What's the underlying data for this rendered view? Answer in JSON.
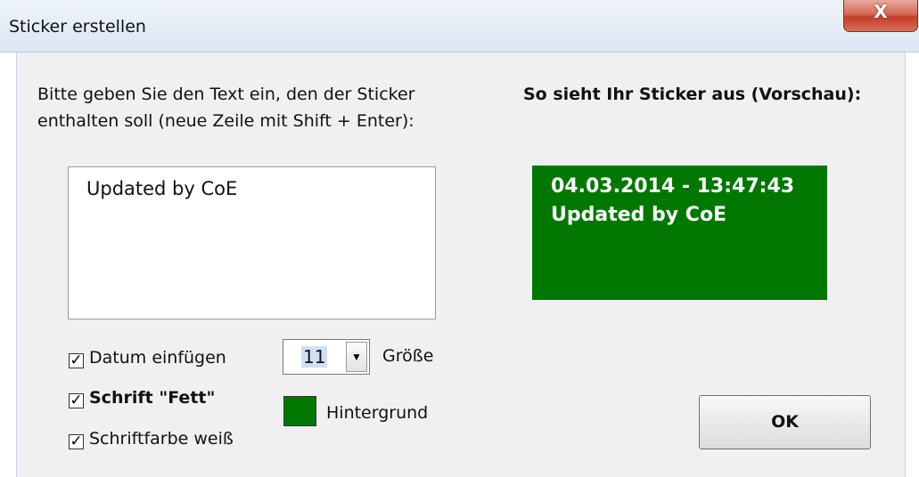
{
  "window": {
    "title": "Sticker erstellen",
    "close_label": "X"
  },
  "instructions": {
    "line1": "Bitte geben Sie den Text ein, den der Sticker",
    "line2": "enthalten soll (neue Zeile mit Shift + Enter):"
  },
  "text_input": {
    "value": "Updated by CoE"
  },
  "preview": {
    "title": "So sieht Ihr Sticker aus (Vorschau):",
    "line1": "04.03.2014 - 13:47:43",
    "line2": "Updated by CoE",
    "background_color": "#007800",
    "text_color": "#ffffff"
  },
  "options": {
    "insert_date": {
      "label": "Datum einfügen",
      "checked": true
    },
    "bold_font": {
      "label": "Schrift \"Fett\"",
      "checked": true
    },
    "white_font": {
      "label": "Schriftfarbe weiß",
      "checked": true
    }
  },
  "font_size": {
    "value": "11",
    "label": "Größe"
  },
  "background": {
    "label": "Hintergrund",
    "color": "#007800"
  },
  "ok_button": {
    "label": "OK"
  }
}
